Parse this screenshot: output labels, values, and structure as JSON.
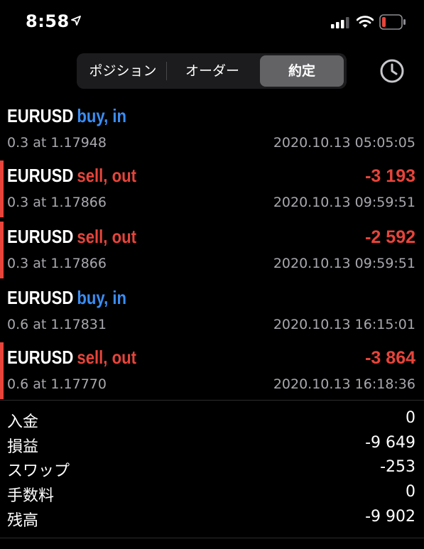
{
  "status_bar": {
    "time": "8:58",
    "icons": [
      "location-arrow-icon",
      "cellular-signal-icon",
      "wifi-icon",
      "battery-low-icon"
    ],
    "battery_color": "#e8443a"
  },
  "tabs": {
    "items": [
      "ポジション",
      "オーダー",
      "約定"
    ],
    "selected": "約定"
  },
  "header_icon": "history-clock-icon",
  "colors": {
    "buy": "#3a8ef6",
    "sell": "#e8443a",
    "muted": "#a8a8ae"
  },
  "deals": [
    {
      "symbol": "EURUSD",
      "side": "buy, in",
      "type": "buy",
      "profit": "",
      "volume_price": "0.3 at 1.17948",
      "time": "2020.10.13 05:05:05"
    },
    {
      "symbol": "EURUSD",
      "side": "sell, out",
      "type": "sell",
      "profit": "-3 193",
      "volume_price": "0.3 at 1.17866",
      "time": "2020.10.13 09:59:51"
    },
    {
      "symbol": "EURUSD",
      "side": "sell, out",
      "type": "sell",
      "profit": "-2 592",
      "volume_price": "0.3 at 1.17866",
      "time": "2020.10.13 09:59:51"
    },
    {
      "symbol": "EURUSD",
      "side": "buy, in",
      "type": "buy",
      "profit": "",
      "volume_price": "0.6 at 1.17831",
      "time": "2020.10.13 16:15:01"
    },
    {
      "symbol": "EURUSD",
      "side": "sell, out",
      "type": "sell",
      "profit": "-3 864",
      "volume_price": "0.6 at 1.17770",
      "time": "2020.10.13 16:18:36"
    }
  ],
  "summary": [
    {
      "label": "入金",
      "value": "0"
    },
    {
      "label": "損益",
      "value": "-9 649"
    },
    {
      "label": "スワップ",
      "value": "-253"
    },
    {
      "label": "手数料",
      "value": "0"
    },
    {
      "label": "残高",
      "value": "-9 902"
    }
  ]
}
